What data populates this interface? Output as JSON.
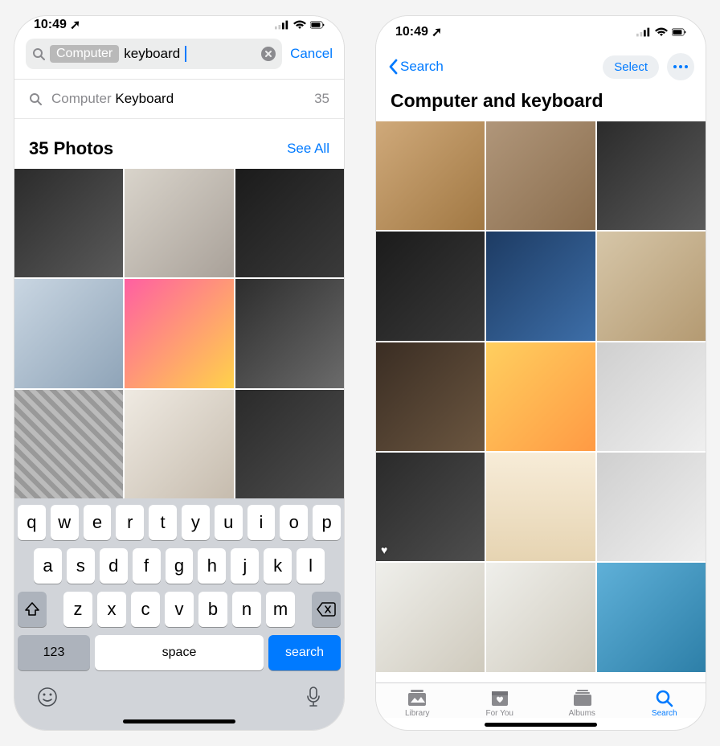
{
  "status": {
    "time": "10:49",
    "location_glyph": "➚"
  },
  "left": {
    "search": {
      "token": "Computer",
      "typed": "keyboard",
      "cancel": "Cancel"
    },
    "suggestion": {
      "grey": "Computer ",
      "bold": "Keyboard",
      "count": "35"
    },
    "section": {
      "title": "35 Photos",
      "see_all": "See All"
    },
    "keyboard": {
      "row1": [
        "q",
        "w",
        "e",
        "r",
        "t",
        "y",
        "u",
        "i",
        "o",
        "p"
      ],
      "row2": [
        "a",
        "s",
        "d",
        "f",
        "g",
        "h",
        "j",
        "k",
        "l"
      ],
      "row3": [
        "z",
        "x",
        "c",
        "v",
        "b",
        "n",
        "m"
      ],
      "numbers_label": "123",
      "space_label": "space",
      "search_label": "search"
    }
  },
  "right": {
    "back_label": "Search",
    "select_label": "Select",
    "title": "Computer and  keyboard",
    "tabs": {
      "library": "Library",
      "for_you": "For You",
      "albums": "Albums",
      "search": "Search"
    }
  }
}
